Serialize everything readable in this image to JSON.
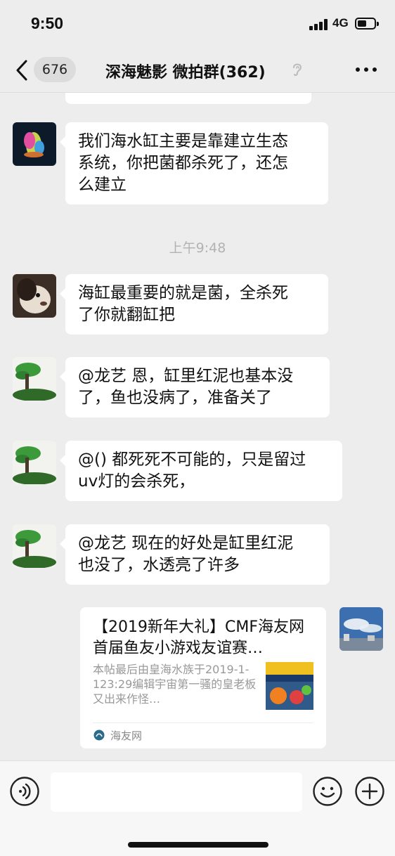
{
  "status_bar": {
    "time": "9:50",
    "network": "4G",
    "battery_level": 0.55
  },
  "nav": {
    "unread_count": "676",
    "title": "深海魅影  微拍群(362)",
    "icons": [
      "back-icon",
      "ear-icon",
      "more-icon"
    ]
  },
  "messages": [
    {
      "sender": "other",
      "lines": [
        "我们海水缸主要是靠建立生态",
        "系统，你把菌都杀死了，还怎",
        "么建立"
      ]
    },
    {
      "sender": "other",
      "lines": [
        "海缸最重要的就是菌，全杀死",
        "了你就翻缸把"
      ]
    },
    {
      "sender": "other",
      "lines": [
        "@龙艺 恩，缸里红泥也基本没",
        "了，鱼也没病了，准备关了"
      ]
    },
    {
      "sender": "other",
      "lines": [
        "@() 都死死不可能的，只是留过",
        "uv灯的会杀死，"
      ]
    },
    {
      "sender": "other",
      "lines": [
        "@龙艺 现在的好处是缸里红泥",
        "也没了，水透亮了许多"
      ]
    }
  ],
  "time_divider": "上午9:48",
  "link_card": {
    "sender": "me",
    "title": "【2019新年大礼】CMF海友网首届鱼友小游戏友谊赛…",
    "description": "本帖最后由皇海水族于2019-1-123:29编辑宇宙第一骚的皇老板又出来作怪…",
    "source": "海友网"
  },
  "input_bar": {
    "placeholder": "",
    "icons": [
      "voice-icon",
      "emoji-icon",
      "plus-icon"
    ]
  },
  "colors": {
    "background": "#ededed",
    "bubble": "#ffffff",
    "time_label": "#b2b2b2"
  }
}
